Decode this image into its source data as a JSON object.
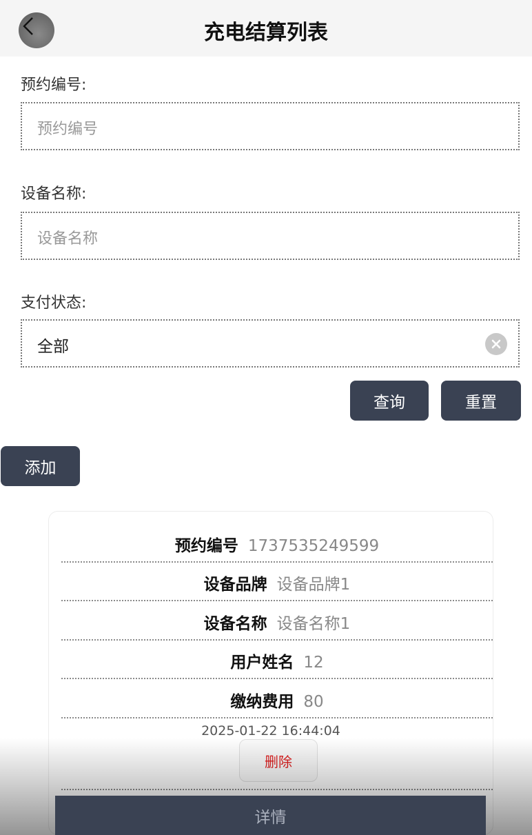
{
  "header": {
    "title": "充电结算列表"
  },
  "search": {
    "booking_no_label": "预约编号:",
    "booking_no_placeholder": "预约编号",
    "device_name_label": "设备名称:",
    "device_name_placeholder": "设备名称",
    "pay_status_label": "支付状态:",
    "pay_status_value": "全部",
    "query_label": "查询",
    "reset_label": "重置"
  },
  "add_label": "添加",
  "card": {
    "rows": [
      {
        "key": "预约编号",
        "value": "1737535249599"
      },
      {
        "key": "设备品牌",
        "value": "设备品牌1"
      },
      {
        "key": "设备名称",
        "value": "设备名称1"
      },
      {
        "key": "用户姓名",
        "value": "12"
      },
      {
        "key": "缴纳费用",
        "value": "80"
      }
    ],
    "timestamp": "2025-01-22 16:44:04",
    "delete_label": "删除",
    "detail_label": "详情"
  },
  "icons": {
    "back": "chevron-left-icon",
    "clear": "clear-circle-icon"
  },
  "colors": {
    "button_dark": "#3a4253",
    "delete_text": "#e02020"
  }
}
